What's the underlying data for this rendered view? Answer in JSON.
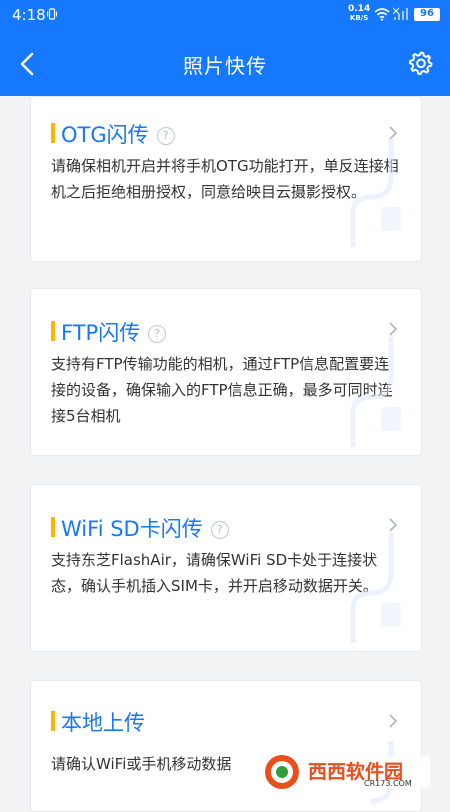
{
  "status_bar": {
    "time": "4:18",
    "net_speed": "0.14",
    "net_unit": "KB/S",
    "battery": "96"
  },
  "header": {
    "title": "照片快传"
  },
  "cards": [
    {
      "title": "OTG闪传",
      "description": "请确保相机开启并将手机OTG功能打开，单反连接相机之后拒绝相册授权，同意给映目云摄影授权。"
    },
    {
      "title": "FTP闪传",
      "description": "支持有FTP传输功能的相机，通过FTP信息配置要连接的设备，确保输入的FTP信息正确，最多可同时连接5台相机"
    },
    {
      "title": "WiFi SD卡闪传",
      "description": "支持东芝FlashAir，请确保WiFi SD卡处于连接状态，确认手机插入SIM卡，并开启移动数据开关。"
    },
    {
      "title": "本地上传",
      "description": "请确认WiFi或手机移动数据"
    }
  ],
  "watermark": {
    "text": "西西软件园",
    "url": "CR173.COM"
  },
  "colors": {
    "primary": "#1677ff",
    "accent_bar": "#ffb400"
  }
}
